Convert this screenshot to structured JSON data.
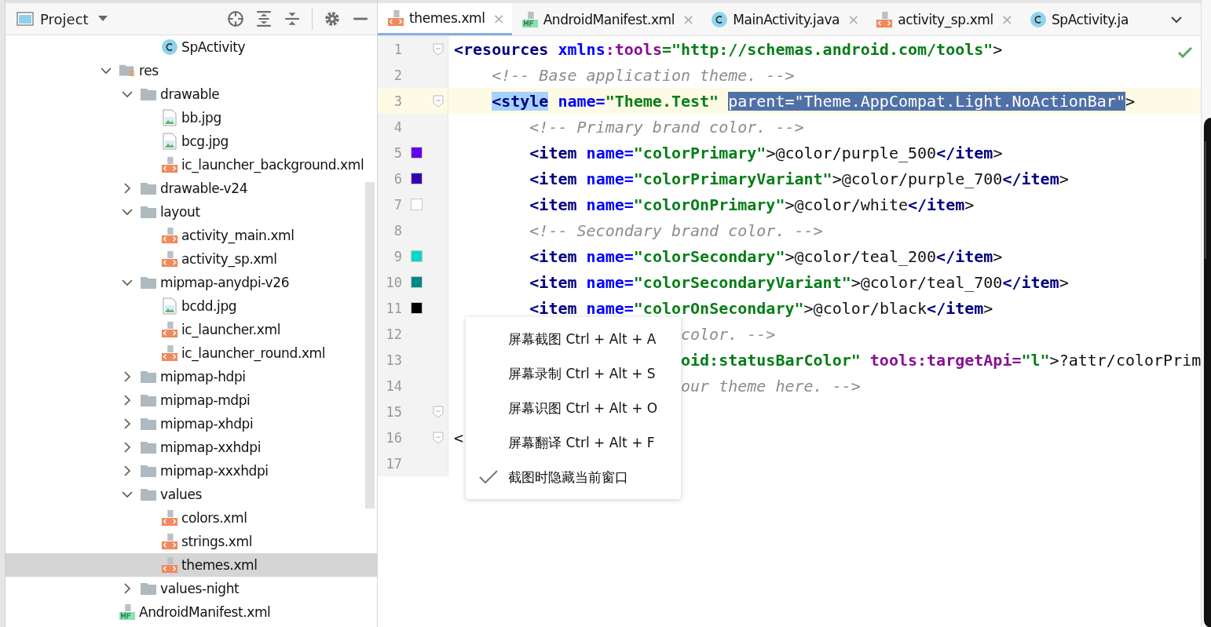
{
  "project_panel": {
    "title": "Project"
  },
  "tree": {
    "above": [
      {
        "label": "SpActivity",
        "kind": "class",
        "selected": false
      }
    ],
    "items": [
      {
        "label": "res",
        "kind": "resfolder",
        "expanded": true,
        "selected": false,
        "children": [
          {
            "label": "drawable",
            "kind": "folder",
            "expanded": true,
            "selected": false,
            "children": [
              {
                "label": "bb.jpg",
                "kind": "image",
                "selected": false
              },
              {
                "label": "bcg.jpg",
                "kind": "image",
                "selected": false
              },
              {
                "label": "ic_launcher_background.xml",
                "kind": "xml",
                "selected": false
              }
            ]
          },
          {
            "label": "drawable-v24",
            "kind": "folder",
            "expanded": false,
            "selected": false
          },
          {
            "label": "layout",
            "kind": "folder",
            "expanded": true,
            "selected": false,
            "children": [
              {
                "label": "activity_main.xml",
                "kind": "xml",
                "selected": false
              },
              {
                "label": "activity_sp.xml",
                "kind": "xml",
                "selected": false
              }
            ]
          },
          {
            "label": "mipmap-anydpi-v26",
            "kind": "folder",
            "expanded": true,
            "selected": false,
            "children": [
              {
                "label": "bcdd.jpg",
                "kind": "image",
                "selected": false
              },
              {
                "label": "ic_launcher.xml",
                "kind": "xml",
                "selected": false
              },
              {
                "label": "ic_launcher_round.xml",
                "kind": "xml",
                "selected": false
              }
            ]
          },
          {
            "label": "mipmap-hdpi",
            "kind": "folder",
            "expanded": false,
            "selected": false
          },
          {
            "label": "mipmap-mdpi",
            "kind": "folder",
            "expanded": false,
            "selected": false
          },
          {
            "label": "mipmap-xhdpi",
            "kind": "folder",
            "expanded": false,
            "selected": false
          },
          {
            "label": "mipmap-xxhdpi",
            "kind": "folder",
            "expanded": false,
            "selected": false
          },
          {
            "label": "mipmap-xxxhdpi",
            "kind": "folder",
            "expanded": false,
            "selected": false
          },
          {
            "label": "values",
            "kind": "folder",
            "expanded": true,
            "selected": false,
            "children": [
              {
                "label": "colors.xml",
                "kind": "xml",
                "selected": false
              },
              {
                "label": "strings.xml",
                "kind": "xml",
                "selected": false
              },
              {
                "label": "themes.xml",
                "kind": "xml",
                "selected": true
              }
            ]
          },
          {
            "label": "values-night",
            "kind": "folder",
            "expanded": false,
            "selected": false
          }
        ]
      },
      {
        "label": "AndroidManifest.xml",
        "kind": "manifest",
        "selected": false
      }
    ]
  },
  "tabs": [
    {
      "label": "themes.xml",
      "kind": "xml",
      "selected": true,
      "closable": true
    },
    {
      "label": "AndroidManifest.xml",
      "kind": "manifest",
      "selected": false,
      "closable": true
    },
    {
      "label": "MainActivity.java",
      "kind": "class",
      "selected": false,
      "closable": true
    },
    {
      "label": "activity_sp.xml",
      "kind": "xml",
      "selected": false,
      "closable": true
    },
    {
      "label": "SpActivity.ja",
      "kind": "class",
      "selected": false,
      "closable": false
    }
  ],
  "tab_close": "×",
  "editor": {
    "lines": [
      {
        "number": "1",
        "current": false,
        "fold": true,
        "tokens": [
          {
            "t": "<resources",
            "kind": "tag"
          },
          {
            "t": " xmlns",
            "kind": "attr"
          },
          {
            "t": ":tools",
            "kind": "ns"
          },
          {
            "t": "=\"http://schemas.android.com/tools\"",
            "kind": "value"
          },
          {
            "t": ">",
            "kind": "text"
          }
        ],
        "children": [
          {
            "number": "2",
            "current": false,
            "fold": false,
            "tokens": [
              {
                "t": "<!-- Base application theme. -->",
                "kind": "comment"
              }
            ]
          },
          {
            "number": "3",
            "current": true,
            "fold": true,
            "tokens": [
              {
                "t": "<style",
                "kind": "matched-tag"
              },
              {
                "t": " name=",
                "kind": "attr"
              },
              {
                "t": "\"Theme.Test\" ",
                "kind": "value"
              },
              {
                "t": "parent=\"Theme.AppCompat.Light.NoActionBar\"",
                "kind": "selection"
              },
              {
                "t": ">",
                "kind": "text"
              }
            ],
            "children": [
              {
                "number": "4",
                "current": false,
                "fold": false,
                "tokens": [
                  {
                    "t": "<!-- Primary brand color. -->",
                    "kind": "comment"
                  }
                ]
              },
              {
                "number": "5",
                "current": false,
                "fold": false,
                "color": "#6200ee",
                "tokens": [
                  {
                    "t": "<item",
                    "kind": "tag"
                  },
                  {
                    "t": " name=",
                    "kind": "attr"
                  },
                  {
                    "t": "\"colorPrimary\"",
                    "kind": "value"
                  },
                  {
                    "t": ">@color/purple_500",
                    "kind": "text"
                  },
                  {
                    "t": "</item",
                    "kind": "tag"
                  },
                  {
                    "t": ">",
                    "kind": "text"
                  }
                ]
              },
              {
                "number": "6",
                "current": false,
                "fold": false,
                "color": "#3700b3",
                "tokens": [
                  {
                    "t": "<item",
                    "kind": "tag"
                  },
                  {
                    "t": " name=",
                    "kind": "attr"
                  },
                  {
                    "t": "\"colorPrimaryVariant\"",
                    "kind": "value"
                  },
                  {
                    "t": ">@color/purple_700",
                    "kind": "text"
                  },
                  {
                    "t": "</item",
                    "kind": "tag"
                  },
                  {
                    "t": ">",
                    "kind": "text"
                  }
                ]
              },
              {
                "number": "7",
                "current": false,
                "fold": false,
                "color": "#ffffff",
                "tokens": [
                  {
                    "t": "<item",
                    "kind": "tag"
                  },
                  {
                    "t": " name=",
                    "kind": "attr"
                  },
                  {
                    "t": "\"colorOnPrimary\"",
                    "kind": "value"
                  },
                  {
                    "t": ">@color/white",
                    "kind": "text"
                  },
                  {
                    "t": "</item",
                    "kind": "tag"
                  },
                  {
                    "t": ">",
                    "kind": "text"
                  }
                ]
              },
              {
                "number": "8",
                "current": false,
                "fold": false,
                "tokens": [
                  {
                    "t": "<!-- Secondary brand color. -->",
                    "kind": "comment"
                  }
                ]
              },
              {
                "number": "9",
                "current": false,
                "fold": false,
                "color": "#03dac5",
                "tokens": [
                  {
                    "t": "<item",
                    "kind": "tag"
                  },
                  {
                    "t": " name=",
                    "kind": "attr"
                  },
                  {
                    "t": "\"colorSecondary\"",
                    "kind": "value"
                  },
                  {
                    "t": ">@color/teal_200",
                    "kind": "text"
                  },
                  {
                    "t": "</item",
                    "kind": "tag"
                  },
                  {
                    "t": ">",
                    "kind": "text"
                  }
                ]
              },
              {
                "number": "10",
                "current": false,
                "fold": false,
                "color": "#018786",
                "tokens": [
                  {
                    "t": "<item",
                    "kind": "tag"
                  },
                  {
                    "t": " name=",
                    "kind": "attr"
                  },
                  {
                    "t": "\"colorSecondaryVariant\"",
                    "kind": "value"
                  },
                  {
                    "t": ">@color/teal_700",
                    "kind": "text"
                  },
                  {
                    "t": "</item",
                    "kind": "tag"
                  },
                  {
                    "t": ">",
                    "kind": "text"
                  }
                ]
              },
              {
                "number": "11",
                "current": false,
                "fold": false,
                "color": "#000000",
                "tokens": [
                  {
                    "t": "<item",
                    "kind": "tag"
                  },
                  {
                    "t": " name=",
                    "kind": "attr"
                  },
                  {
                    "t": "\"colorOnSecondary\"",
                    "kind": "value"
                  },
                  {
                    "t": ">@color/black",
                    "kind": "text"
                  },
                  {
                    "t": "</item",
                    "kind": "tag"
                  },
                  {
                    "t": ">",
                    "kind": "text"
                  }
                ]
              },
              {
                "number": "12",
                "current": false,
                "fold": false,
                "tokens": [
                  {
                    "kind": "covered"
                  },
                  {
                    "t": "color. -->",
                    "kind": "comment"
                  }
                ]
              },
              {
                "number": "13",
                "current": false,
                "fold": false,
                "tokens": [
                  {
                    "kind": "covered"
                  },
                  {
                    "t": "oid:statusBarColor\"",
                    "kind": "value"
                  },
                  {
                    "t": " tools:targetApi=",
                    "kind": "ns"
                  },
                  {
                    "t": "\"l\"",
                    "kind": "value"
                  },
                  {
                    "t": ">?attr/colorPrim",
                    "kind": "text"
                  }
                ]
              },
              {
                "number": "14",
                "current": false,
                "fold": false,
                "tokens": [
                  {
                    "kind": "covered"
                  },
                  {
                    "t": "our theme here. -->",
                    "kind": "comment"
                  }
                ]
              }
            ]
          },
          {
            "number": "15",
            "current": false,
            "fold": true
          }
        ]
      },
      {
        "number": "16",
        "current": false,
        "fold": true,
        "tokens": [
          {
            "t": "<",
            "kind": "text"
          }
        ]
      },
      {
        "number": "17",
        "current": false,
        "fold": false
      }
    ]
  },
  "context_menu": {
    "items": [
      {
        "label": "屏幕截图 Ctrl + Alt + A",
        "kind": "command"
      },
      {
        "label": "屏幕录制 Ctrl + Alt + S",
        "kind": "command"
      },
      {
        "label": "屏幕识图 Ctrl + Alt + O",
        "kind": "command"
      },
      {
        "label": "屏幕翻译 Ctrl + Alt + F",
        "kind": "command"
      },
      {
        "label": "截图时隐藏当前窗口",
        "kind": "toggle",
        "checked": true
      }
    ]
  }
}
